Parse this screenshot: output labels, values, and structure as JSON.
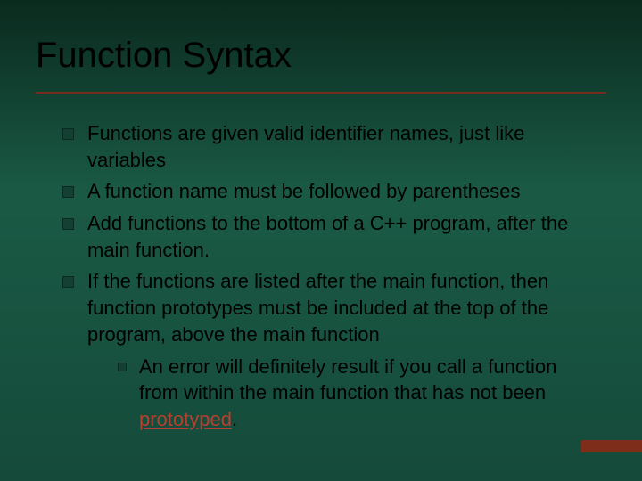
{
  "title": "Function Syntax",
  "bullets": [
    {
      "text": "Functions are given valid identifier names, just like variables"
    },
    {
      "text": "A function name must be followed by parentheses"
    },
    {
      "text": "Add functions to the bottom of a C++ program, after the main function."
    },
    {
      "text": "If the functions are listed after the main function, then function prototypes must be included at the top of the program, above the main function",
      "sub": [
        {
          "prefix": "An error will definitely result if you call a function from within the main function that has not been ",
          "link": "prototyped",
          "suffix": "."
        }
      ]
    }
  ]
}
